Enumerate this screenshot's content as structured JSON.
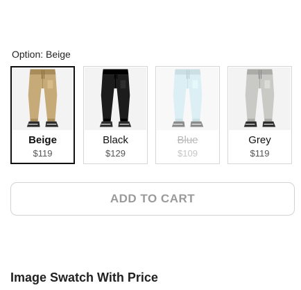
{
  "option": {
    "label": "Option: Beige"
  },
  "swatches": [
    {
      "name": "Beige",
      "price": "$119",
      "color": "#c6aa78",
      "selected": true,
      "available": true
    },
    {
      "name": "Black",
      "price": "$129",
      "color": "#1c1c1c",
      "selected": false,
      "available": true
    },
    {
      "name": "Blue",
      "price": "$109",
      "color": "#bfe3ec",
      "selected": false,
      "available": false
    },
    {
      "name": "Grey",
      "price": "$119",
      "color": "#c9c9c6",
      "selected": false,
      "available": true
    }
  ],
  "cart": {
    "button_label": "ADD TO CART"
  },
  "section": {
    "title": "Image Swatch With Price"
  }
}
